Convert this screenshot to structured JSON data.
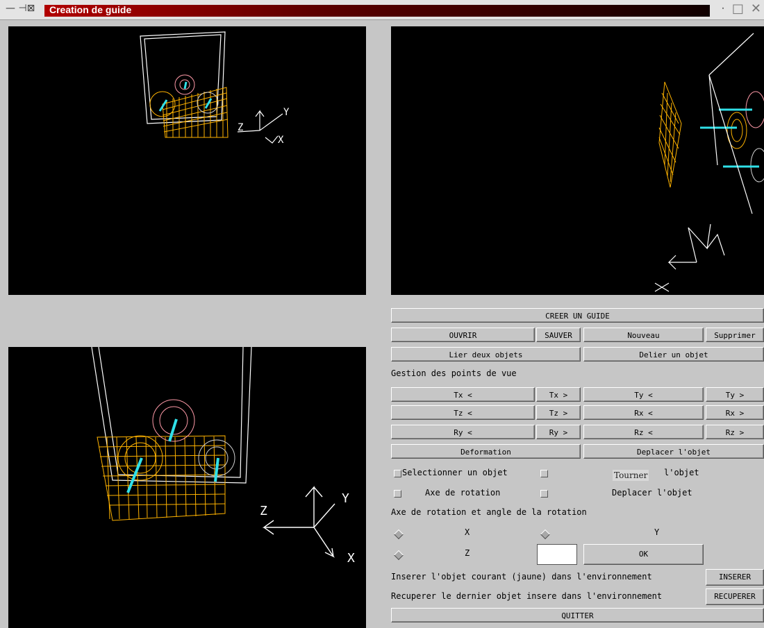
{
  "window": {
    "title": "Creation de guide"
  },
  "buttons": {
    "creer": "CREER UN GUIDE",
    "ouvrir": "OUVRIR",
    "sauver": "SAUVER",
    "nouveau": "Nouveau",
    "supprimer": "Supprimer",
    "lier": "Lier deux objets",
    "delier": "Delier un objet",
    "tx_minus": "Tx <",
    "tx_plus": "Tx >",
    "ty_minus": "Ty <",
    "ty_plus": "Ty >",
    "tz_minus": "Tz <",
    "tz_plus": "Tz >",
    "rx_minus": "Rx <",
    "rx_plus": "Rx >",
    "ry_minus": "Ry <",
    "ry_plus": "Ry >",
    "rz_minus": "Rz <",
    "rz_plus": "Rz >",
    "deformation": "Deformation",
    "deplacer": "Deplacer l'objet",
    "ok": "OK",
    "inserer": "INSERER",
    "recuperer": "RECUPERER",
    "quitter": "QUITTER"
  },
  "labels": {
    "gestion": "Gestion des points de vue",
    "selectionner": "Selectionner un objet",
    "tourner": "l'objet",
    "axe_rotation": "Axe de rotation",
    "deplacer_obj": "Deplacer l'objet",
    "axe_angle": "Axe de rotation et angle de la rotation",
    "x": "X",
    "y": "Y",
    "z": "Z",
    "inserer_desc": "Inserer l'objet courant (jaune) dans l'environnement",
    "recuperer_desc": "Recuperer le dernier objet insere dans l'environnement"
  },
  "tooltip": "Tourner",
  "angle_entry": {
    "value": ""
  },
  "viewports": {
    "axis_labels": [
      "X",
      "Y",
      "Z"
    ]
  },
  "colors": {
    "object_current": "#ffb300",
    "object_pink": "#ff9aa8",
    "object_gray": "#d0d0d0",
    "axis_cyan": "#30e0e8",
    "wireframe": "#ffffff"
  }
}
